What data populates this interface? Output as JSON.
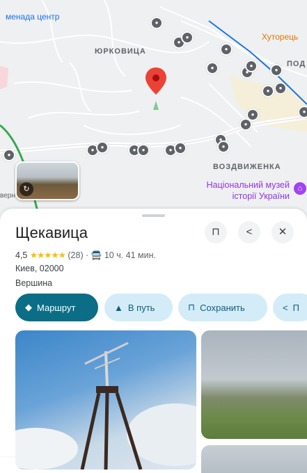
{
  "map": {
    "labels": {
      "top_left_link": "менада центр",
      "district1": "ЮРКОВИЦА",
      "district2": "ВОЗДВИЖЕНКА",
      "orange": "Хуторець",
      "right_cut": "ПОД",
      "left_cut": "верн"
    },
    "museum": "Національний музей історії України",
    "thumbnail_badge": "360"
  },
  "place": {
    "title": "Щекавица",
    "rating": "4,5",
    "stars": "★★★★★",
    "reviews": "(28)",
    "separator": "·",
    "transit_time": "10 ч. 41 мин.",
    "address": "Киев, 02000",
    "category": "Вершина"
  },
  "actions": {
    "route": "Маршрут",
    "go": "В путь",
    "save": "Сохранить",
    "share_cut": "П"
  },
  "colors": {
    "accent": "#0b6e86",
    "chip": "#d3ecf8",
    "pin": "#ea4335",
    "stars": "#fbbc04"
  }
}
